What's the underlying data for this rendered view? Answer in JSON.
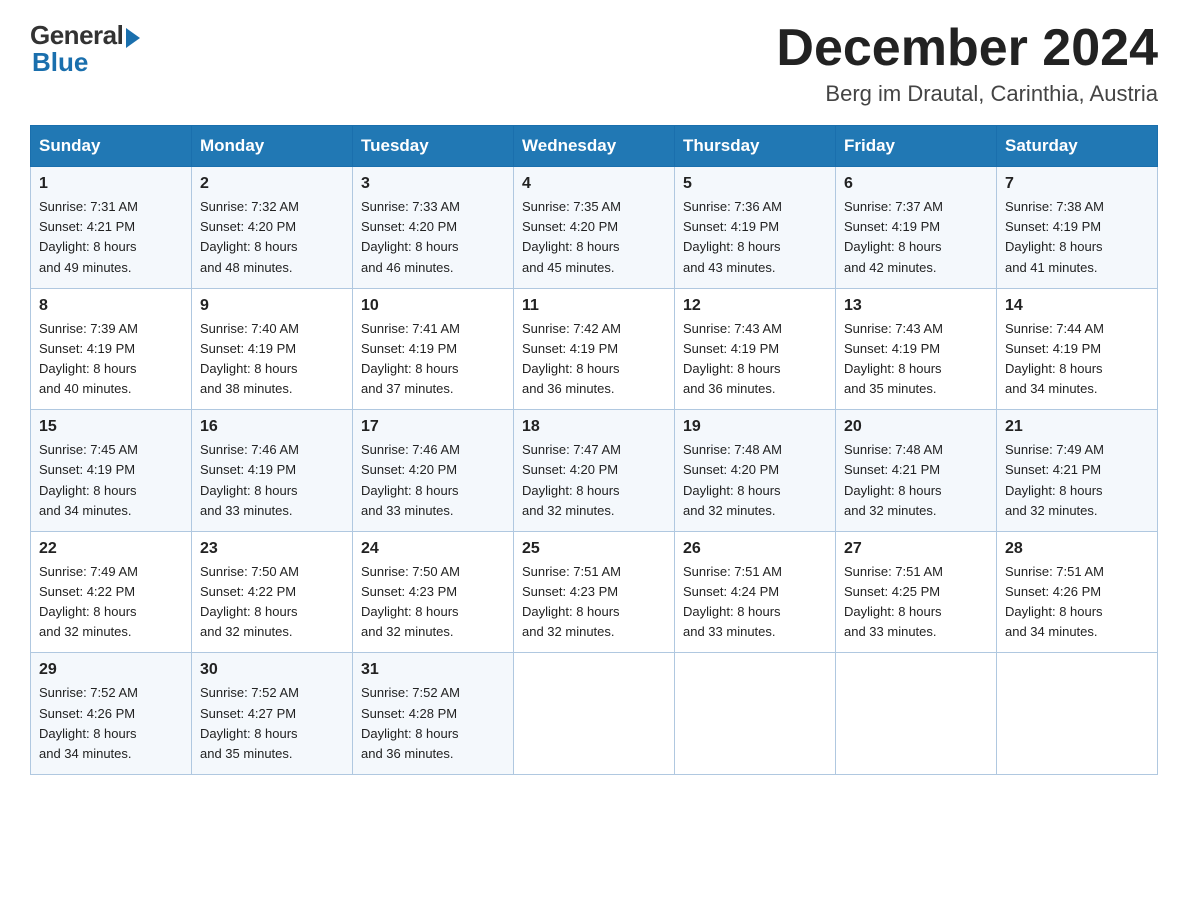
{
  "logo": {
    "general": "General",
    "blue": "Blue"
  },
  "title": {
    "month_year": "December 2024",
    "location": "Berg im Drautal, Carinthia, Austria"
  },
  "days_of_week": [
    "Sunday",
    "Monday",
    "Tuesday",
    "Wednesday",
    "Thursday",
    "Friday",
    "Saturday"
  ],
  "weeks": [
    [
      {
        "day": "1",
        "sunrise": "7:31 AM",
        "sunset": "4:21 PM",
        "daylight": "8 hours and 49 minutes."
      },
      {
        "day": "2",
        "sunrise": "7:32 AM",
        "sunset": "4:20 PM",
        "daylight": "8 hours and 48 minutes."
      },
      {
        "day": "3",
        "sunrise": "7:33 AM",
        "sunset": "4:20 PM",
        "daylight": "8 hours and 46 minutes."
      },
      {
        "day": "4",
        "sunrise": "7:35 AM",
        "sunset": "4:20 PM",
        "daylight": "8 hours and 45 minutes."
      },
      {
        "day": "5",
        "sunrise": "7:36 AM",
        "sunset": "4:19 PM",
        "daylight": "8 hours and 43 minutes."
      },
      {
        "day": "6",
        "sunrise": "7:37 AM",
        "sunset": "4:19 PM",
        "daylight": "8 hours and 42 minutes."
      },
      {
        "day": "7",
        "sunrise": "7:38 AM",
        "sunset": "4:19 PM",
        "daylight": "8 hours and 41 minutes."
      }
    ],
    [
      {
        "day": "8",
        "sunrise": "7:39 AM",
        "sunset": "4:19 PM",
        "daylight": "8 hours and 40 minutes."
      },
      {
        "day": "9",
        "sunrise": "7:40 AM",
        "sunset": "4:19 PM",
        "daylight": "8 hours and 38 minutes."
      },
      {
        "day": "10",
        "sunrise": "7:41 AM",
        "sunset": "4:19 PM",
        "daylight": "8 hours and 37 minutes."
      },
      {
        "day": "11",
        "sunrise": "7:42 AM",
        "sunset": "4:19 PM",
        "daylight": "8 hours and 36 minutes."
      },
      {
        "day": "12",
        "sunrise": "7:43 AM",
        "sunset": "4:19 PM",
        "daylight": "8 hours and 36 minutes."
      },
      {
        "day": "13",
        "sunrise": "7:43 AM",
        "sunset": "4:19 PM",
        "daylight": "8 hours and 35 minutes."
      },
      {
        "day": "14",
        "sunrise": "7:44 AM",
        "sunset": "4:19 PM",
        "daylight": "8 hours and 34 minutes."
      }
    ],
    [
      {
        "day": "15",
        "sunrise": "7:45 AM",
        "sunset": "4:19 PM",
        "daylight": "8 hours and 34 minutes."
      },
      {
        "day": "16",
        "sunrise": "7:46 AM",
        "sunset": "4:19 PM",
        "daylight": "8 hours and 33 minutes."
      },
      {
        "day": "17",
        "sunrise": "7:46 AM",
        "sunset": "4:20 PM",
        "daylight": "8 hours and 33 minutes."
      },
      {
        "day": "18",
        "sunrise": "7:47 AM",
        "sunset": "4:20 PM",
        "daylight": "8 hours and 32 minutes."
      },
      {
        "day": "19",
        "sunrise": "7:48 AM",
        "sunset": "4:20 PM",
        "daylight": "8 hours and 32 minutes."
      },
      {
        "day": "20",
        "sunrise": "7:48 AM",
        "sunset": "4:21 PM",
        "daylight": "8 hours and 32 minutes."
      },
      {
        "day": "21",
        "sunrise": "7:49 AM",
        "sunset": "4:21 PM",
        "daylight": "8 hours and 32 minutes."
      }
    ],
    [
      {
        "day": "22",
        "sunrise": "7:49 AM",
        "sunset": "4:22 PM",
        "daylight": "8 hours and 32 minutes."
      },
      {
        "day": "23",
        "sunrise": "7:50 AM",
        "sunset": "4:22 PM",
        "daylight": "8 hours and 32 minutes."
      },
      {
        "day": "24",
        "sunrise": "7:50 AM",
        "sunset": "4:23 PM",
        "daylight": "8 hours and 32 minutes."
      },
      {
        "day": "25",
        "sunrise": "7:51 AM",
        "sunset": "4:23 PM",
        "daylight": "8 hours and 32 minutes."
      },
      {
        "day": "26",
        "sunrise": "7:51 AM",
        "sunset": "4:24 PM",
        "daylight": "8 hours and 33 minutes."
      },
      {
        "day": "27",
        "sunrise": "7:51 AM",
        "sunset": "4:25 PM",
        "daylight": "8 hours and 33 minutes."
      },
      {
        "day": "28",
        "sunrise": "7:51 AM",
        "sunset": "4:26 PM",
        "daylight": "8 hours and 34 minutes."
      }
    ],
    [
      {
        "day": "29",
        "sunrise": "7:52 AM",
        "sunset": "4:26 PM",
        "daylight": "8 hours and 34 minutes."
      },
      {
        "day": "30",
        "sunrise": "7:52 AM",
        "sunset": "4:27 PM",
        "daylight": "8 hours and 35 minutes."
      },
      {
        "day": "31",
        "sunrise": "7:52 AM",
        "sunset": "4:28 PM",
        "daylight": "8 hours and 36 minutes."
      },
      null,
      null,
      null,
      null
    ]
  ],
  "labels": {
    "sunrise": "Sunrise:",
    "sunset": "Sunset:",
    "daylight": "Daylight:"
  }
}
